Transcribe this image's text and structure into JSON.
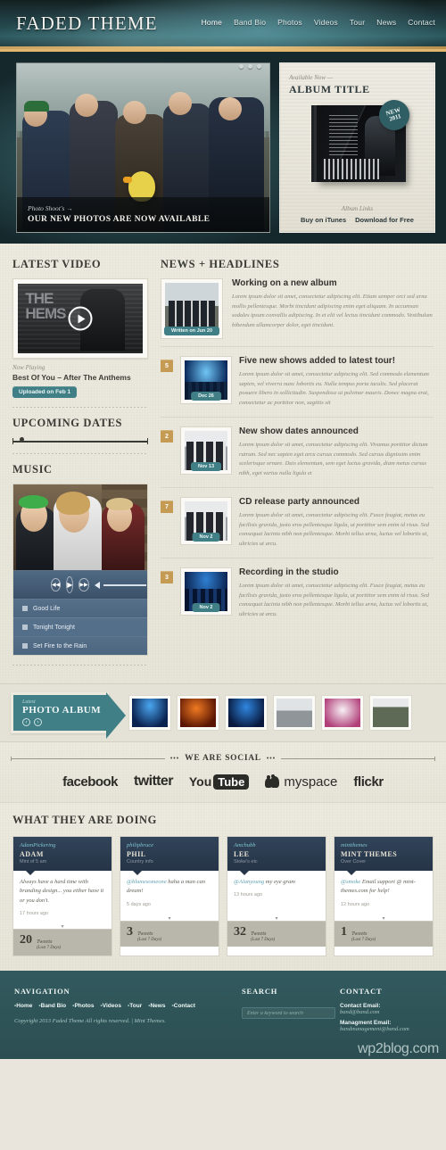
{
  "site": {
    "logo": "FADED THEME"
  },
  "nav": {
    "items": [
      "Home",
      "Band Bio",
      "Photos",
      "Videos",
      "Tour",
      "News",
      "Contact"
    ]
  },
  "hero": {
    "slide": {
      "kicker": "Photo Shoot's →",
      "title": "OUR NEW PHOTOS ARE NOW AVAILABLE"
    },
    "album": {
      "kicker": "Available Now —",
      "title": "ALBUM TITLE",
      "badge_line1": "NEW",
      "badge_line2": "2011",
      "links_label": "Album Links",
      "link1": "Buy on iTunes",
      "link2": "Download for Free"
    }
  },
  "video": {
    "heading": "LATEST VIDEO",
    "thumb_text": "THE\nHEMS",
    "now_playing_label": "Now Playing",
    "title": "Best Of You – After The Anthems",
    "badge": "Uploaded on Feb 1"
  },
  "dates": {
    "heading": "UPCOMING DATES"
  },
  "music": {
    "heading": "MUSIC",
    "controls": {
      "prev": "◀◀",
      "play": "▶",
      "next": "▶▶"
    },
    "tracks": [
      "Good Life",
      "Tonight Tonight",
      "Set Fire to the Rain"
    ]
  },
  "news": {
    "heading": "NEWS + HEADLINES",
    "lead": {
      "title": "Working on a new album",
      "date_badge": "Written on Jun 20",
      "body": "Lorem ipsum dolor sit amet, consectetur adipiscing elit. Etiam semper orci sed urna mollis pellentesque. Morbi tincidunt adipiscing enim eget aliquam. In accumsan sodales ipsum convallis adipiscing. In et elit vel lectus tincidunt commodo. Vestibulum bibendum ullamcorper dolor, eget tincidunt."
    },
    "items": [
      {
        "num": "5",
        "title": "Five new shows added to latest tour!",
        "date_badge": "Dec 26",
        "body": "Lorem ipsum dolor sit amet, consectetur adipiscing elit. Sed commodo elementum sapien, vel viverra nunc lobortis eu. Nulla tempus porta iaculis. Sed placerat posuere libero in sollicitudin. Suspendisse ut pulvinar mauris. Donec magna erat, consectetur ac porttitor non, sagittis sit"
      },
      {
        "num": "2",
        "title": "New show dates announced",
        "date_badge": "Nov 13",
        "body": "Lorem ipsum dolor sit amet, consectetur adipiscing elit. Vivamus porttitor dictum rutrum. Sed nec sapien eget arcu cursus commodo. Sed cursus dignissim enim scelerisque ornare. Duis elementum, sem eget luctus gravida, diam metus cursus nibh, eget varius nulla ligula et"
      },
      {
        "num": "7",
        "title": "CD release party announced",
        "date_badge": "Nov 2",
        "body": "Lorem ipsum dolor sit amet, consectetur adipiscing elit. Fusce feugiat, metus eu facilisis gravida, justo eros pellentesque ligula, ut porttitor sem enim id risus. Sed consequat lacinia nibh non pellentesque. Morbi tellus urna, luctus vel lobortis ut, ultricies ut arcu."
      },
      {
        "num": "3",
        "title": "Recording in the studio",
        "date_badge": "Nov 2",
        "body": "Lorem ipsum dolor sit amet, consectetur adipiscing elit. Fusce feugiat, metus eu facilisis gravida, justo eros pellentesque ligula, ut porttitor sem enim id risus. Sed consequat lacinia nibh non pellentesque. Morbi tellus urna, luctus vel lobortis ut, ultricies ut arcu."
      }
    ]
  },
  "album_strip": {
    "kicker": "Latest",
    "title": "PHOTO ALBUM",
    "prev_icon": "‹",
    "next_icon": "›",
    "thumb_count": 6
  },
  "social": {
    "heading": "WE ARE SOCIAL",
    "dots_left": "•••",
    "dots_right": "•••",
    "networks": [
      "facebook",
      "twitter",
      "YouTube",
      "myspace",
      "flickr"
    ],
    "youtube_part1": "You",
    "youtube_part2": "Tube"
  },
  "twitter": {
    "heading": "WHAT THEY ARE DOING",
    "cards": [
      {
        "handle": "AdamPickering",
        "name": "ADAM",
        "sub": "Mint of 5 am",
        "text": "Always have a hard time with branding design... you either have it or you don't.",
        "mention": "",
        "time": "17 hours ago",
        "count": "20",
        "count_label": "Tweets",
        "count_sub": "(Last 7 Days)"
      },
      {
        "handle": "philipbruce",
        "name": "PHIL",
        "sub": "Country info",
        "text": " haha a man can dream!",
        "mention": "@blamesomeone",
        "time": "5 days ago",
        "count": "3",
        "count_label": "Tweets",
        "count_sub": "(Last 7 Days)"
      },
      {
        "handle": "Amchubb",
        "name": "LEE",
        "sub": "Stoke's etc",
        "text": " my eye gram",
        "mention": "@Alanyoung",
        "time": "13 hours ago",
        "count": "32",
        "count_label": "Tweets",
        "count_sub": "(Last 7 Days)"
      },
      {
        "handle": "mintthemes",
        "name": "MINT THEMES",
        "sub": "Over Cover",
        "text": " Email support @ mint-themes.com for help!",
        "mention": "@smoke",
        "time": "12 hours ago",
        "count": "1",
        "count_label": "Tweets",
        "count_sub": "(Last 7 Days)"
      }
    ]
  },
  "footer": {
    "nav_heading": "NAVIGATION",
    "nav_items": [
      "Home",
      "Band Bio",
      "Photos",
      "Videos",
      "Tour",
      "News",
      "Contact"
    ],
    "copyright": "Copyright 2013 Faded Theme All rights reserved. | Mint Themes.",
    "search_heading": "SEARCH",
    "search_placeholder": "Enter a keyword to search",
    "search_value": "",
    "contact_heading": "CONTACT",
    "contact_label": "Contact Email:",
    "contact_email": "band@band.com",
    "management_label": "Managment Email:",
    "management_email": "bandmanagement@band.com",
    "watermark": "wp2blog.com"
  },
  "colors": {
    "teal": "#3f7f85",
    "gold": "#c59a53",
    "paper": "#eceadf",
    "footer": "#2f5257"
  }
}
